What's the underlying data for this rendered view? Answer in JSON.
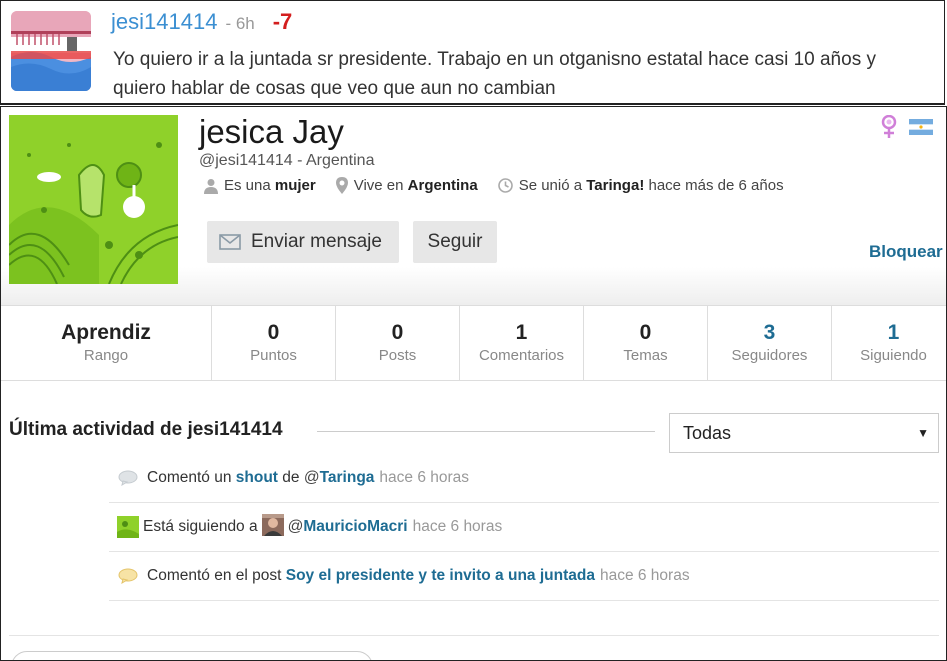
{
  "comment": {
    "username": "jesi141414",
    "time": "- 6h",
    "score": "-7",
    "text": "Yo quiero ir a la juntada sr presidente. Trabajo en un otganisno estatal hace casi 10 años y quiero hablar de cosas que veo que aun no cambian"
  },
  "profile": {
    "name": "jesica Jay",
    "handle": "@jesi141414 - Argentina",
    "gender_prefix": "Es una",
    "gender": "mujer",
    "location_prefix": "Vive en",
    "location": "Argentina",
    "joined_prefix": "Se unió a",
    "joined_site": "Taringa!",
    "joined_suffix": "hace más de 6 años",
    "send_message_label": "Enviar mensaje",
    "follow_label": "Seguir",
    "block_label": "Bloquear"
  },
  "stats": {
    "rank_value": "Aprendiz",
    "rank_label": "Rango",
    "items": [
      {
        "value": "0",
        "label": "Puntos"
      },
      {
        "value": "0",
        "label": "Posts"
      },
      {
        "value": "1",
        "label": "Comentarios"
      },
      {
        "value": "0",
        "label": "Temas"
      },
      {
        "value": "3",
        "label": "Seguidores"
      },
      {
        "value": "1",
        "label": "Siguiendo"
      }
    ]
  },
  "activity": {
    "title": "Última actividad de jesi141414",
    "filter_value": "Todas",
    "items": [
      {
        "prefix": "Comentó un",
        "link": "shout",
        "middle": "de",
        "at": "@",
        "mention": "Taringa",
        "ago": "hace 6 horas"
      },
      {
        "prefix": "Está siguiendo a",
        "at": "@",
        "mention": "MauricioMacri",
        "ago": "hace 6 horas"
      },
      {
        "prefix": "Comentó en el post",
        "link": "Soy el presidente y te invito a una juntada",
        "ago": "hace 6 horas"
      }
    ]
  },
  "colors": {
    "link": "#1e6c93",
    "username": "#3b8fd2",
    "score_negative": "#d31e1e",
    "avatar_green": "#8fd12a"
  }
}
